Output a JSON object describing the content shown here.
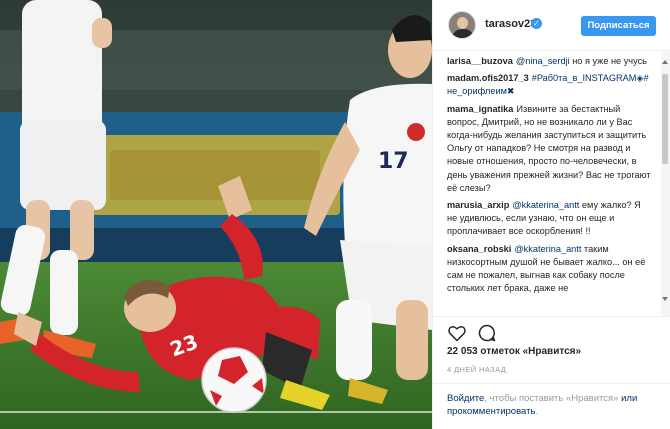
{
  "photo": {
    "alt_icon": "football-match-photo",
    "jersey_number": "17",
    "player_number_red": "23",
    "colors": {
      "pitch": "#3f7a2c",
      "red_kit": "#d3232b",
      "white_kit": "#f4f4f4",
      "board": "#c8b03a"
    }
  },
  "header": {
    "username": "tarasov23",
    "verified_icon": "verified-badge-icon",
    "follow_label": "Подписаться"
  },
  "comments": [
    {
      "author": "larisa__buzova",
      "mention": "@nina_serdji",
      "text": " но я уже не учусь"
    },
    {
      "author": "madam.ofis2017_3",
      "mention": "",
      "text": "#Раб0та_в_INSTAGRAM◈#не_орифлеим✖"
    },
    {
      "author": "mama_ignatika",
      "mention": "",
      "text": "Извините за бестактный вопрос, Дмитрий, но не возникало ли у Вас когда-нибудь желания заступиться и защитить Ольгу от нападков? Не смотря на развод и новые отношения, просто по-человечески, в день уважения прежней жизни? Вас не трогают её слезы?"
    },
    {
      "author": "marusia_arxip",
      "mention": "@kkaterina_antt",
      "text": " ему жалко? Я не удивлюсь, если узнаю, что он еще и проплачивает все оскорбления! !!"
    },
    {
      "author": "oksana_robski",
      "mention": "@kkaterina_antt",
      "text": " таким низкосортным душой не бывает жалко... он её сам не пожалел, выгнав как собаку после стольких лет брака, даже не"
    }
  ],
  "actions": {
    "like_icon": "heart-icon",
    "comment_icon": "speech-bubble-icon"
  },
  "likes_text": "22 053 отметок «Нравится»",
  "time_text": "4 ДНЕЙ НАЗАД",
  "login": {
    "link1": "Войдите",
    "text1": ", чтобы поставить «Нравится» ",
    "link2": "или прокомментировать",
    "text2": "."
  }
}
